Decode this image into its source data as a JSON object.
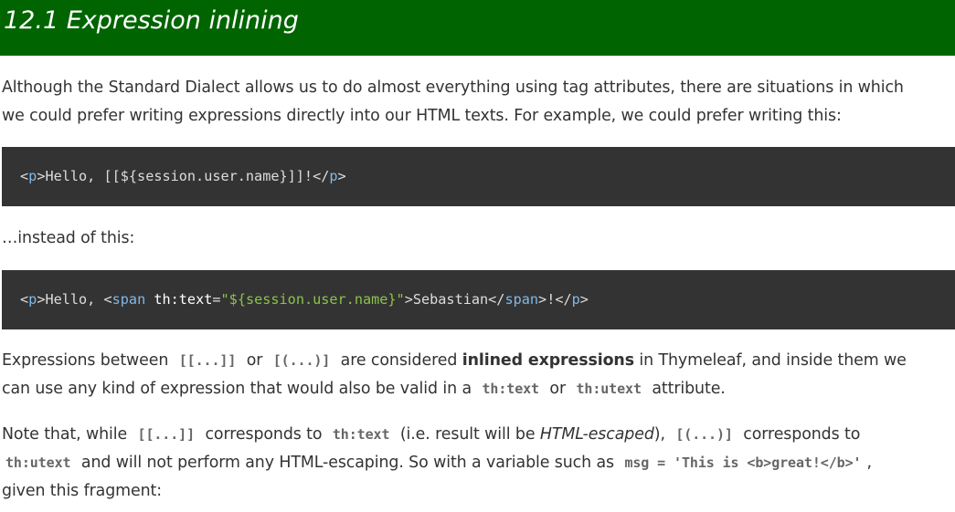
{
  "section": {
    "title": "12.1 Expression inlining"
  },
  "intro": {
    "line1": "Although the Standard Dialect allows us to do almost everything using tag attributes, there are situations in which",
    "line2": "we could prefer writing expressions directly into our HTML texts. For example, we could prefer writing this:"
  },
  "code1": {
    "lt": "<",
    "tag_p": "p",
    "gt": ">",
    "text": "Hello, [[${session.user.name}]]!",
    "close_lt": "</",
    "close_tag_p": "p",
    "close_gt": ">"
  },
  "instead": {
    "text": "…instead of this:"
  },
  "code2": {
    "open_p_lt": "<",
    "open_p_tag": "p",
    "open_p_gt": ">",
    "hello": "Hello, ",
    "span_lt": "<",
    "span_tag": "span",
    "attr_name": " th:text",
    "equals": "=",
    "attr_value": "\"${session.user.name}\"",
    "span_gt": ">",
    "sebastian": "Sebastian",
    "span_close_lt": "</",
    "span_close_tag": "span",
    "span_close_gt": ">",
    "bang": "!",
    "p_close_lt": "</",
    "p_close_tag": "p",
    "p_close_gt": ">"
  },
  "para2": {
    "t1": "Expressions between",
    "c1": "[[...]]",
    "t2": "or",
    "c2": "[(...)]",
    "t3": "are considered",
    "bold": "inlined expressions",
    "t4": "in Thymeleaf, and inside them we",
    "t5": "can use any kind of expression that would also be valid in a",
    "c3": "th:text",
    "t6": "or",
    "c4": "th:utext",
    "t7": "attribute."
  },
  "para3": {
    "t1": "Note that, while",
    "c1": "[[...]]",
    "t2": "corresponds to",
    "c2": "th:text",
    "t3": "(i.e. result will be",
    "em": "HTML-escaped",
    "t4": "),",
    "c3": "[(...)]",
    "t5": "corresponds to",
    "c4": "th:utext",
    "t6": "and will not perform any HTML-escaping. So with a variable such as",
    "c5": "msg = 'This is <b>great!</b>'",
    "t7": ",",
    "t8": "given this fragment:"
  }
}
